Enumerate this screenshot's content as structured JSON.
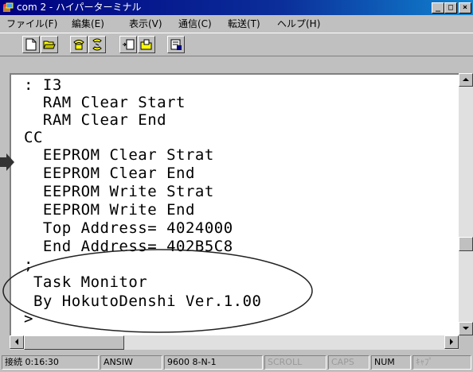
{
  "window": {
    "title": "com 2 - ハイパーターミナル",
    "controls": {
      "minimize": "_",
      "maximize": "□",
      "close": "×"
    }
  },
  "menu": [
    {
      "label": "ファイル(F)"
    },
    {
      "label": "編集(E)"
    },
    {
      "label": "表示(V)"
    },
    {
      "label": "通信(C)"
    },
    {
      "label": "転送(T)"
    },
    {
      "label": "ヘルプ(H)"
    }
  ],
  "toolbar": {
    "icons": [
      "new-icon",
      "open-icon",
      "connect-icon",
      "disconnect-icon",
      "send-icon",
      "receive-icon",
      "properties-icon"
    ]
  },
  "terminal": {
    "lines": [
      ": I3",
      "  RAM Clear Start",
      "  RAM Clear End",
      "CC",
      "  EEPROM Clear Strat",
      "  EEPROM Clear End",
      "  EEPROM Write Strat",
      "  EEPROM Write End",
      "  Top Address= 4024000",
      "  End Address= 402B5C8",
      ";",
      " Task Monitor",
      " By HokutoDenshi Ver.1.00",
      ">"
    ]
  },
  "status": {
    "connection": "接続 0:16:30",
    "emulation": "ANSIW",
    "settings": "9600 8-N-1",
    "scroll": "SCROLL",
    "caps": "CAPS",
    "num": "NUM",
    "capture": "ｷｬﾌﾟ"
  },
  "colors": {
    "titlebar": "#000080",
    "annotation": "#222222"
  }
}
